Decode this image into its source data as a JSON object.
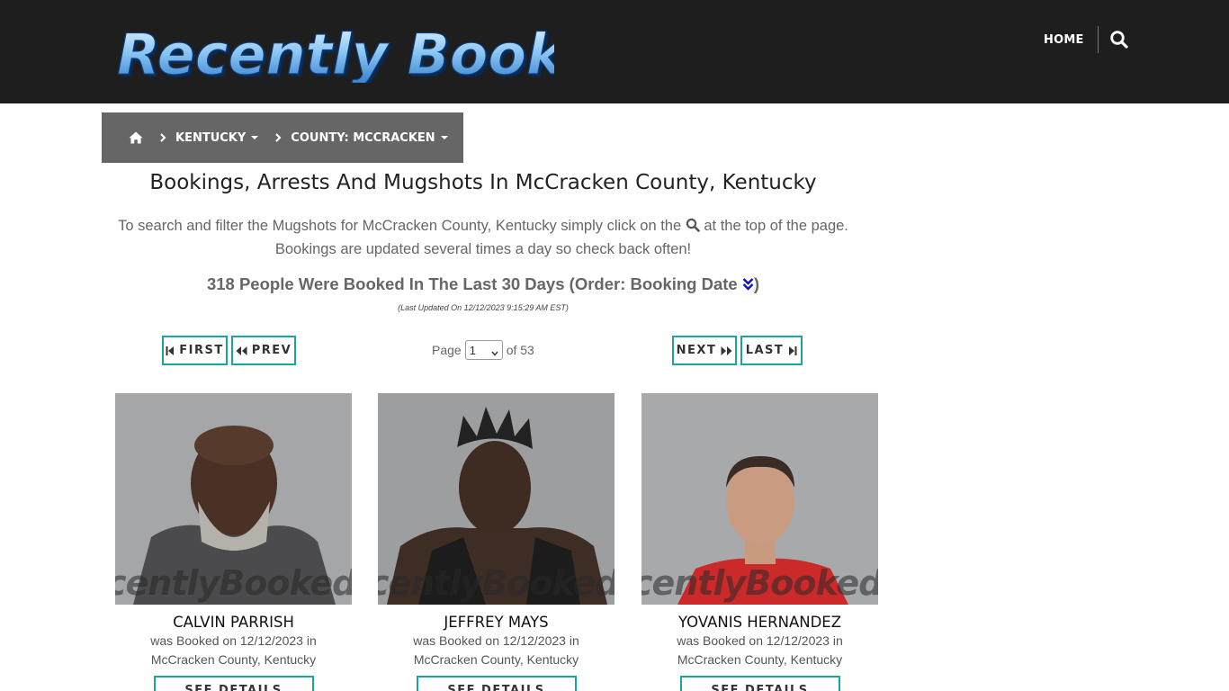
{
  "header": {
    "logo_text": "Recently Booked",
    "nav_home": "HOME",
    "search_icon": "search-icon"
  },
  "breadcrumb": {
    "home_icon": "home-icon",
    "state": "KENTUCKY",
    "county": "COUNTY: MCCRACKEN"
  },
  "main": {
    "title": "Bookings, Arrests And Mugshots In McCracken County, Kentucky",
    "intro_part1": "To search and filter the Mugshots for McCracken County, Kentucky simply click on the",
    "intro_part2": "at the top of the page.",
    "intro_line2": "Bookings are updated several times a day so check back often!",
    "count_text": "318 People Were Booked In The Last 30 Days (Order: Booking Date",
    "count_close": ")",
    "updated": "(Last Updated On 12/12/2023 9:15:29 AM EST)"
  },
  "pager": {
    "first": "FIRST",
    "prev": "PREV",
    "next": "NEXT",
    "last": "LAST",
    "page_label": "Page",
    "current_page": "1",
    "of_label": "of 53"
  },
  "cards": [
    {
      "name": "CALVIN PARRISH",
      "booked": "was Booked on 12/12/2023 in",
      "location": "McCracken County, Kentucky",
      "details": "SEE DETAILS",
      "watermark": "centlyBooked.co"
    },
    {
      "name": "JEFFREY MAYS",
      "booked": "was Booked on 12/12/2023 in",
      "location": "McCracken County, Kentucky",
      "details": "SEE DETAILS",
      "watermark": "centlyBooked.co"
    },
    {
      "name": "YOVANIS HERNANDEZ",
      "booked": "was Booked on 12/12/2023 in",
      "location": "McCracken County, Kentucky",
      "details": "SEE DETAILS",
      "watermark": "centlyBooked.co"
    }
  ],
  "colors": {
    "header_bg": "#1e1e1e",
    "breadcrumb_bg": "#666666",
    "accent": "#1aa5a0",
    "order_icon": "#1010c8"
  }
}
